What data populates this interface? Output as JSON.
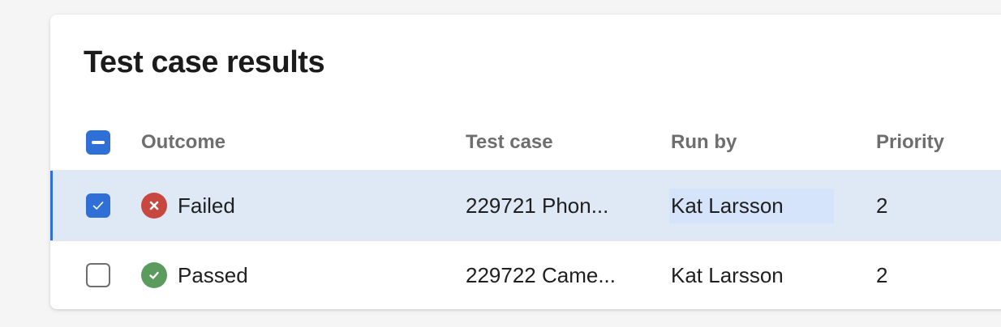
{
  "title": "Test case results",
  "columns": {
    "outcome": "Outcome",
    "test_case": "Test case",
    "run_by": "Run by",
    "priority": "Priority"
  },
  "header_checkbox_state": "indeterminate",
  "rows": [
    {
      "selected": true,
      "outcome": "Failed",
      "outcome_icon": "failed-x-icon",
      "test_case": "229721 Phon...",
      "run_by": "Kat Larsson",
      "priority": "2"
    },
    {
      "selected": false,
      "outcome": "Passed",
      "outcome_icon": "passed-check-icon",
      "test_case": "229722 Came...",
      "run_by": "Kat Larsson",
      "priority": "2"
    }
  ],
  "colors": {
    "accent": "#2f6fd6",
    "selected_row": "#dfe9f6",
    "failed": "#c8473f",
    "passed": "#5b9c5e"
  }
}
